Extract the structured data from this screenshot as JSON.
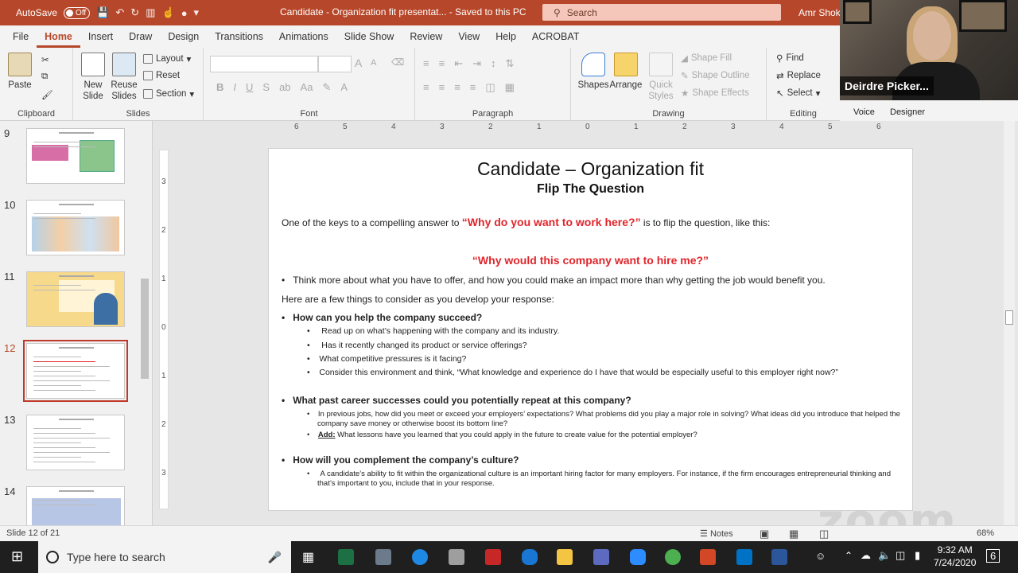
{
  "titlebar": {
    "autosave_label": "AutoSave",
    "autosave_state": "Off",
    "doc_title": "Candidate - Organization fit presentat...  -  Saved to this PC",
    "search_placeholder": "Search",
    "user": "Amr Shokr"
  },
  "menu": [
    "File",
    "Home",
    "Insert",
    "Draw",
    "Design",
    "Transitions",
    "Animations",
    "Slide Show",
    "Review",
    "View",
    "Help",
    "ACROBAT"
  ],
  "ribbon": {
    "clipboard": {
      "paste": "Paste",
      "label": "Clipboard"
    },
    "slides": {
      "new_slide": "New Slide",
      "reuse_slides": "Reuse Slides",
      "layout": "Layout",
      "reset": "Reset",
      "section": "Section",
      "label": "Slides"
    },
    "font": {
      "label": "Font",
      "bold": "B",
      "italic": "I",
      "underline": "U",
      "strike": "S",
      "grow": "A",
      "shrink": "A"
    },
    "paragraph": {
      "label": "Paragraph"
    },
    "drawing": {
      "shapes": "Shapes",
      "arrange": "Arrange",
      "quick_styles": "Quick Styles",
      "shape_fill": "Shape Fill",
      "shape_outline": "Shape Outline",
      "shape_effects": "Shape Effects",
      "label": "Drawing"
    },
    "editing": {
      "find": "Find",
      "replace": "Replace",
      "select": "Select",
      "label": "Editing"
    },
    "voice": "Voice",
    "designer": "Designer"
  },
  "webcam": {
    "name": "Deirdre Picker..."
  },
  "thumbnails": [
    {
      "num": "9"
    },
    {
      "num": "10"
    },
    {
      "num": "11"
    },
    {
      "num": "12",
      "active": true
    },
    {
      "num": "13"
    },
    {
      "num": "14"
    }
  ],
  "slide": {
    "title": "Candidate – Organization fit",
    "subtitle": "Flip The Question",
    "intro_pre": "One of the keys to a compelling answer to ",
    "intro_quote": "“Why do you want to work here?”",
    "intro_post": " is to flip the question, like this:",
    "flip_quote": "“Why would this company want to hire me?”",
    "bullet_think": "Think more about what you have to offer, and how you could make an impact more than why getting the job would benefit you.",
    "consider": "Here are a few things to consider as you develop your response:",
    "q1": "How can you help the company succeed?",
    "q1_items": [
      "Read up on what’s happening with the company and its industry.",
      "Has it recently changed its product or service offerings?",
      "What competitive pressures is it facing?",
      "Consider this environment and think, “What knowledge and experience do I have that would be especially useful to this employer right now?”"
    ],
    "q2": "What past career successes could you potentially repeat at this company?",
    "q2_item1a": "In previous jobs, how did you meet or exceed your employers’ expectations? What problems did you play a major role in solving? What ideas did you introduce that helped the",
    "q2_item1b": "company save money or otherwise boost its bottom line?",
    "q2_add_label": "Add:",
    "q2_add": " What lessons have you learned that you could apply in the future to create value for the potential employer?",
    "q3": "How will you complement the company’s culture?",
    "q3_item_a": "A candidate’s ability to fit within the organizational culture is an important hiring factor for many employers. For instance, if the firm encourages entrepreneurial thinking and",
    "q3_item_b": "that’s important to you, include that in your response."
  },
  "ruler_h": [
    "6",
    "5",
    "4",
    "3",
    "2",
    "1",
    "0",
    "1",
    "2",
    "3",
    "4",
    "5",
    "6"
  ],
  "ruler_v": [
    "3",
    "2",
    "1",
    "0",
    "1",
    "2",
    "3"
  ],
  "status": {
    "slide_info": "Slide 12 of 21",
    "notes": "Notes",
    "zoom": "68%"
  },
  "taskbar": {
    "search": "Type here to search",
    "time": "9:32 AM",
    "date": "7/24/2020",
    "notif": "6"
  },
  "watermark": "zoom"
}
